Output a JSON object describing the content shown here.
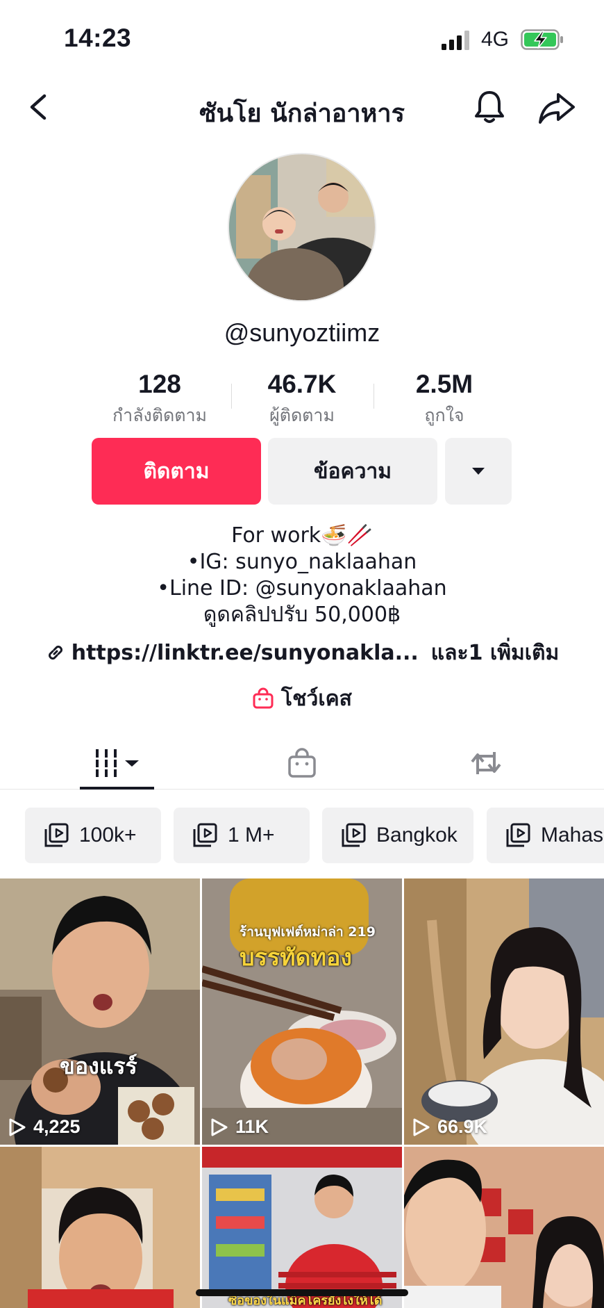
{
  "status_bar": {
    "time": "14:23",
    "network": "4G"
  },
  "nav": {
    "title": "ซันโย นักล่าอาหาร",
    "back_icon": "chevron-left-icon",
    "bell_icon": "bell-icon",
    "share_icon": "share-arrow-icon"
  },
  "profile": {
    "username": "@sunyoztiimz",
    "stats": [
      {
        "value": "128",
        "label": "กำลังติดตาม"
      },
      {
        "value": "46.7K",
        "label": "ผู้ติดตาม"
      },
      {
        "value": "2.5M",
        "label": "ถูกใจ"
      }
    ],
    "buttons": {
      "follow": "ติดตาม",
      "message": "ข้อความ"
    },
    "bio": [
      "For work🍜🥢",
      "•IG: sunyo_naklaahan",
      "•Line ID: @sunyonaklaahan",
      "ดูดคลิปปรับ 50,000฿"
    ],
    "link": {
      "url": "https://linktr.ee/sunyonakla...",
      "more": "และ1 เพิ่มเติม"
    },
    "showcase": "โชว์เคส"
  },
  "colors": {
    "accent": "#fe2c55",
    "text": "#161823",
    "muted": "#73757b",
    "chip_bg": "#f1f1f2"
  },
  "chips": [
    "100k+",
    "1 M+",
    "Bangkok",
    "Mahas"
  ],
  "videos": [
    {
      "views": "4,225",
      "overlay": "ของแรร์"
    },
    {
      "views": "11K",
      "overlay_top": "ร้านบุฟเฟต์หม่าล่า 219",
      "overlay": "บรรทัดทอง"
    },
    {
      "views": "66.9K"
    },
    {},
    {
      "overlay_bottom": "ซื้อของในแม็คโครยังไงให้ได้ของนี้"
    },
    {}
  ]
}
